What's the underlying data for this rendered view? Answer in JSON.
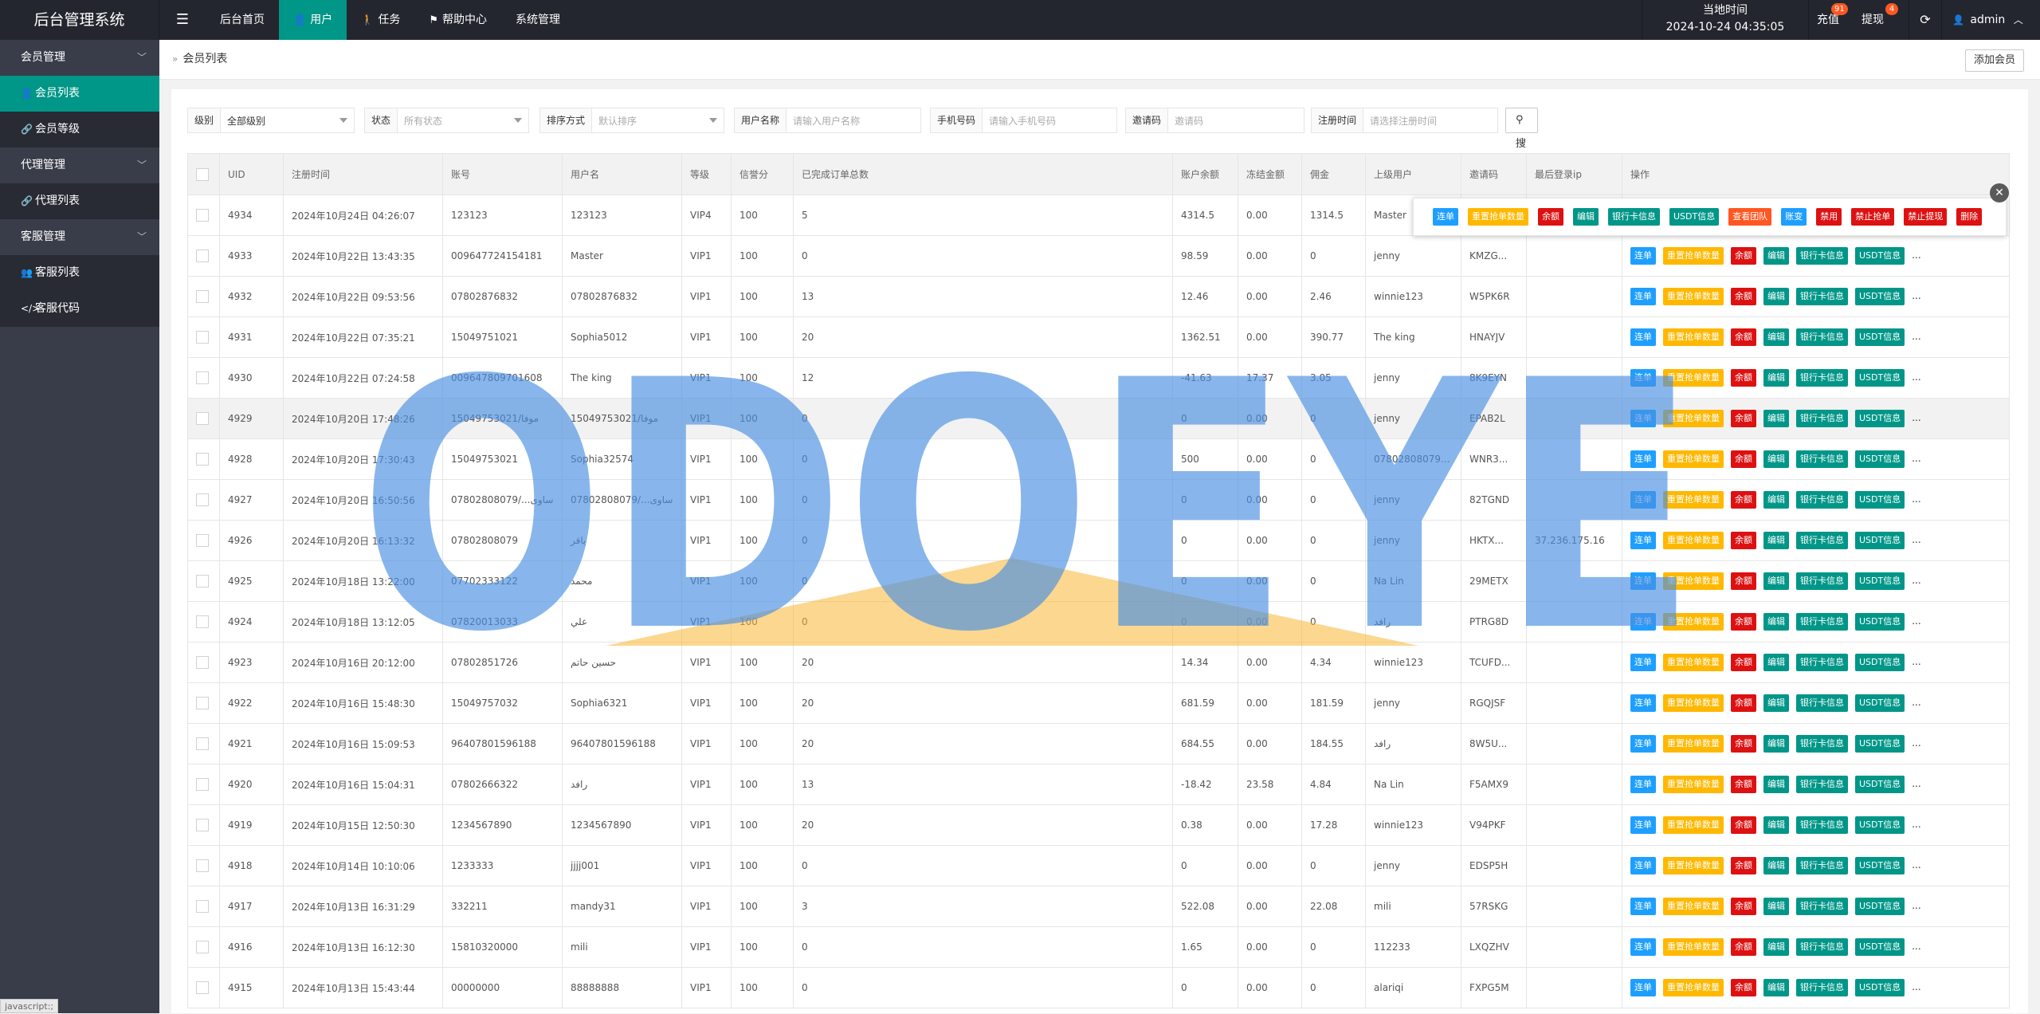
{
  "app": {
    "title": "后台管理系统",
    "menu_icon": "hamburger-icon"
  },
  "topnav": [
    {
      "label": "后台首页",
      "icon": "",
      "active": false
    },
    {
      "label": "用户",
      "icon": "user-icon",
      "active": true
    },
    {
      "label": "任务",
      "icon": "figure-icon",
      "active": false
    },
    {
      "label": "帮助中心",
      "icon": "flag-icon",
      "active": false
    },
    {
      "label": "系统管理",
      "icon": "",
      "active": false
    }
  ],
  "clock": {
    "label": "当地时间",
    "value": "2024-10-24 04:35:05"
  },
  "recharge": {
    "label": "充值",
    "count": "91"
  },
  "withdraw": {
    "label": "提现",
    "count": "4"
  },
  "admin": {
    "label": "admin"
  },
  "sidebar": {
    "groups": [
      {
        "label": "会员管理",
        "items": [
          {
            "label": "会员列表",
            "icon": "user-icon",
            "active": true
          },
          {
            "label": "会员等级",
            "icon": "link-icon",
            "active": false
          }
        ]
      },
      {
        "label": "代理管理",
        "items": [
          {
            "label": "代理列表",
            "icon": "link-icon",
            "active": false
          }
        ]
      },
      {
        "label": "客服管理",
        "items": [
          {
            "label": "客服列表",
            "icon": "users-icon",
            "active": false
          },
          {
            "label": "客服代码",
            "icon": "code-icon",
            "active": false
          }
        ]
      }
    ]
  },
  "breadcrumb": "会员列表",
  "add_member": "添加会员",
  "filters": {
    "level": {
      "label": "级别",
      "value": "全部级别"
    },
    "status": {
      "label": "状态",
      "placeholder": "所有状态"
    },
    "sort": {
      "label": "排序方式",
      "placeholder": "默认排序"
    },
    "username": {
      "label": "用户名称",
      "placeholder": "请输入用户名称"
    },
    "phone": {
      "label": "手机号码",
      "placeholder": "请输入手机号码"
    },
    "invite": {
      "label": "邀请码",
      "placeholder": "邀请码"
    },
    "regtime": {
      "label": "注册时间",
      "placeholder": "请选择注册时间"
    },
    "search": "搜索"
  },
  "table": {
    "headers": [
      "UID",
      "注册时间",
      "账号",
      "用户名",
      "等级",
      "信誉分",
      "已完成订单总数",
      "账户余额",
      "冻结金额",
      "佣金",
      "上级用户",
      "邀请码",
      "最后登录ip",
      "操作"
    ],
    "rows": [
      [
        "4934",
        "2024年10月24日 04:26:07",
        "123123",
        "123123",
        "VIP4",
        "100",
        "5",
        "4314.5",
        "0.00",
        "1314.5",
        "Master",
        "",
        "",
        ""
      ],
      [
        "4933",
        "2024年10月22日 13:43:35",
        "009647724154181",
        "Master",
        "VIP1",
        "100",
        "0",
        "98.59",
        "0.00",
        "0",
        "jenny",
        "KMZG...",
        "",
        ""
      ],
      [
        "4932",
        "2024年10月22日 09:53:56",
        "07802876832",
        "07802876832",
        "VIP1",
        "100",
        "13",
        "12.46",
        "0.00",
        "2.46",
        "winnie123",
        "W5PK6R",
        "",
        ""
      ],
      [
        "4931",
        "2024年10月22日 07:35:21",
        "15049751021",
        "Sophia5012",
        "VIP1",
        "100",
        "20",
        "1362.51",
        "0.00",
        "390.77",
        "The king",
        "HNAYJV",
        "",
        ""
      ],
      [
        "4930",
        "2024年10月22日 07:24:58",
        "009647809701608",
        "The king",
        "VIP1",
        "100",
        "12",
        "-41.63",
        "17.37",
        "3.05",
        "jenny",
        "8K9EYN",
        "",
        ""
      ],
      [
        "4929",
        "2024年10月20日 17:48:26",
        "15049753021/موفا",
        "15049753021/موفا",
        "VIP1",
        "100",
        "0",
        "0",
        "0.00",
        "0",
        "jenny",
        "EPAB2L",
        "",
        ""
      ],
      [
        "4928",
        "2024年10月20日 17:30:43",
        "15049753021",
        "Sophia32574",
        "VIP1",
        "100",
        "0",
        "500",
        "0.00",
        "0",
        "07802808079...",
        "WNR3...",
        "",
        ""
      ],
      [
        "4927",
        "2024年10月20日 16:50:56",
        "07802808079/...ساوى",
        "07802808079/...ساوى",
        "VIP1",
        "100",
        "0",
        "0",
        "0.00",
        "0",
        "jenny",
        "82TGND",
        "",
        ""
      ],
      [
        "4926",
        "2024年10月20日 16:13:32",
        "07802808079",
        "ياقر",
        "VIP1",
        "100",
        "0",
        "0",
        "0.00",
        "0",
        "jenny",
        "HKTX...",
        "37.236.175.16",
        ""
      ],
      [
        "4925",
        "2024年10月18日 13:22:00",
        "07702333122",
        "محمد",
        "VIP1",
        "100",
        "0",
        "0",
        "0.00",
        "0",
        "Na Lin",
        "29METX",
        "",
        ""
      ],
      [
        "4924",
        "2024年10月18日 13:12:05",
        "07820013033",
        "علي",
        "VIP1",
        "100",
        "0",
        "0",
        "0.00",
        "0",
        "رافد",
        "PTRG8D",
        "",
        ""
      ],
      [
        "4923",
        "2024年10月16日 20:12:00",
        "07802851726",
        "حسين حاتم",
        "VIP1",
        "100",
        "20",
        "14.34",
        "0.00",
        "4.34",
        "winnie123",
        "TCUFD...",
        "",
        ""
      ],
      [
        "4922",
        "2024年10月16日 15:48:30",
        "15049757032",
        "Sophia6321",
        "VIP1",
        "100",
        "20",
        "681.59",
        "0.00",
        "181.59",
        "jenny",
        "RGQJSF",
        "",
        ""
      ],
      [
        "4921",
        "2024年10月16日 15:09:53",
        "96407801596188",
        "96407801596188",
        "VIP1",
        "100",
        "20",
        "684.55",
        "0.00",
        "184.55",
        "رافد",
        "8W5U...",
        "",
        ""
      ],
      [
        "4920",
        "2024年10月16日 15:04:31",
        "07802666322",
        "رافد",
        "VIP1",
        "100",
        "13",
        "-18.42",
        "23.58",
        "4.84",
        "Na Lin",
        "F5AMX9",
        "",
        ""
      ],
      [
        "4919",
        "2024年10月15日 12:50:30",
        "1234567890",
        "1234567890",
        "VIP1",
        "100",
        "20",
        "0.38",
        "0.00",
        "17.28",
        "winnie123",
        "V94PKF",
        "",
        ""
      ],
      [
        "4918",
        "2024年10月14日 10:10:06",
        "1233333",
        "jjjj001",
        "VIP1",
        "100",
        "0",
        "0",
        "0.00",
        "0",
        "jenny",
        "EDSP5H",
        "",
        ""
      ],
      [
        "4917",
        "2024年10月13日 16:31:29",
        "332211",
        "mandy31",
        "VIP1",
        "100",
        "3",
        "522.08",
        "0.00",
        "22.08",
        "mili",
        "57RSKG",
        "",
        ""
      ],
      [
        "4916",
        "2024年10月13日 16:12:30",
        "15810320000",
        "mili",
        "VIP1",
        "100",
        "0",
        "1.65",
        "0.00",
        "0",
        "112233",
        "LXQZHV",
        "",
        ""
      ],
      [
        "4915",
        "2024年10月13日 15:43:44",
        "00000000",
        "88888888",
        "VIP1",
        "100",
        "0",
        "0",
        "0.00",
        "0",
        "alariqi",
        "FXPG5M",
        "",
        ""
      ]
    ],
    "row_actions": [
      {
        "label": "连单",
        "color": "#1e9fff"
      },
      {
        "label": "重置抢单数量",
        "color": "#ffb800"
      },
      {
        "label": "余额",
        "color": "#dd1111"
      },
      {
        "label": "编辑",
        "color": "#009688"
      },
      {
        "label": "银行卡信息",
        "color": "#009688"
      },
      {
        "label": "USDT信息",
        "color": "#009688"
      }
    ],
    "more": "..."
  },
  "popup_actions": [
    {
      "label": "连单",
      "color": "#1e9fff"
    },
    {
      "label": "重置抢单数量",
      "color": "#ffb800"
    },
    {
      "label": "余额",
      "color": "#dd1111"
    },
    {
      "label": "编辑",
      "color": "#009688"
    },
    {
      "label": "银行卡信息",
      "color": "#009688"
    },
    {
      "label": "USDT信息",
      "color": "#009688"
    },
    {
      "label": "查看团队",
      "color": "#ff5722"
    },
    {
      "label": "账变",
      "color": "#1e9fff"
    },
    {
      "label": "禁用",
      "color": "#dd1111"
    },
    {
      "label": "禁止抢单",
      "color": "#dd1111"
    },
    {
      "label": "禁止提现",
      "color": "#dd1111"
    },
    {
      "label": "删除",
      "color": "#dd1111"
    }
  ],
  "watermark": {
    "text": "ODOEYE",
    "color": "#4a90e2",
    "accent": "#f7b733"
  },
  "statusbar": "javascript:;"
}
